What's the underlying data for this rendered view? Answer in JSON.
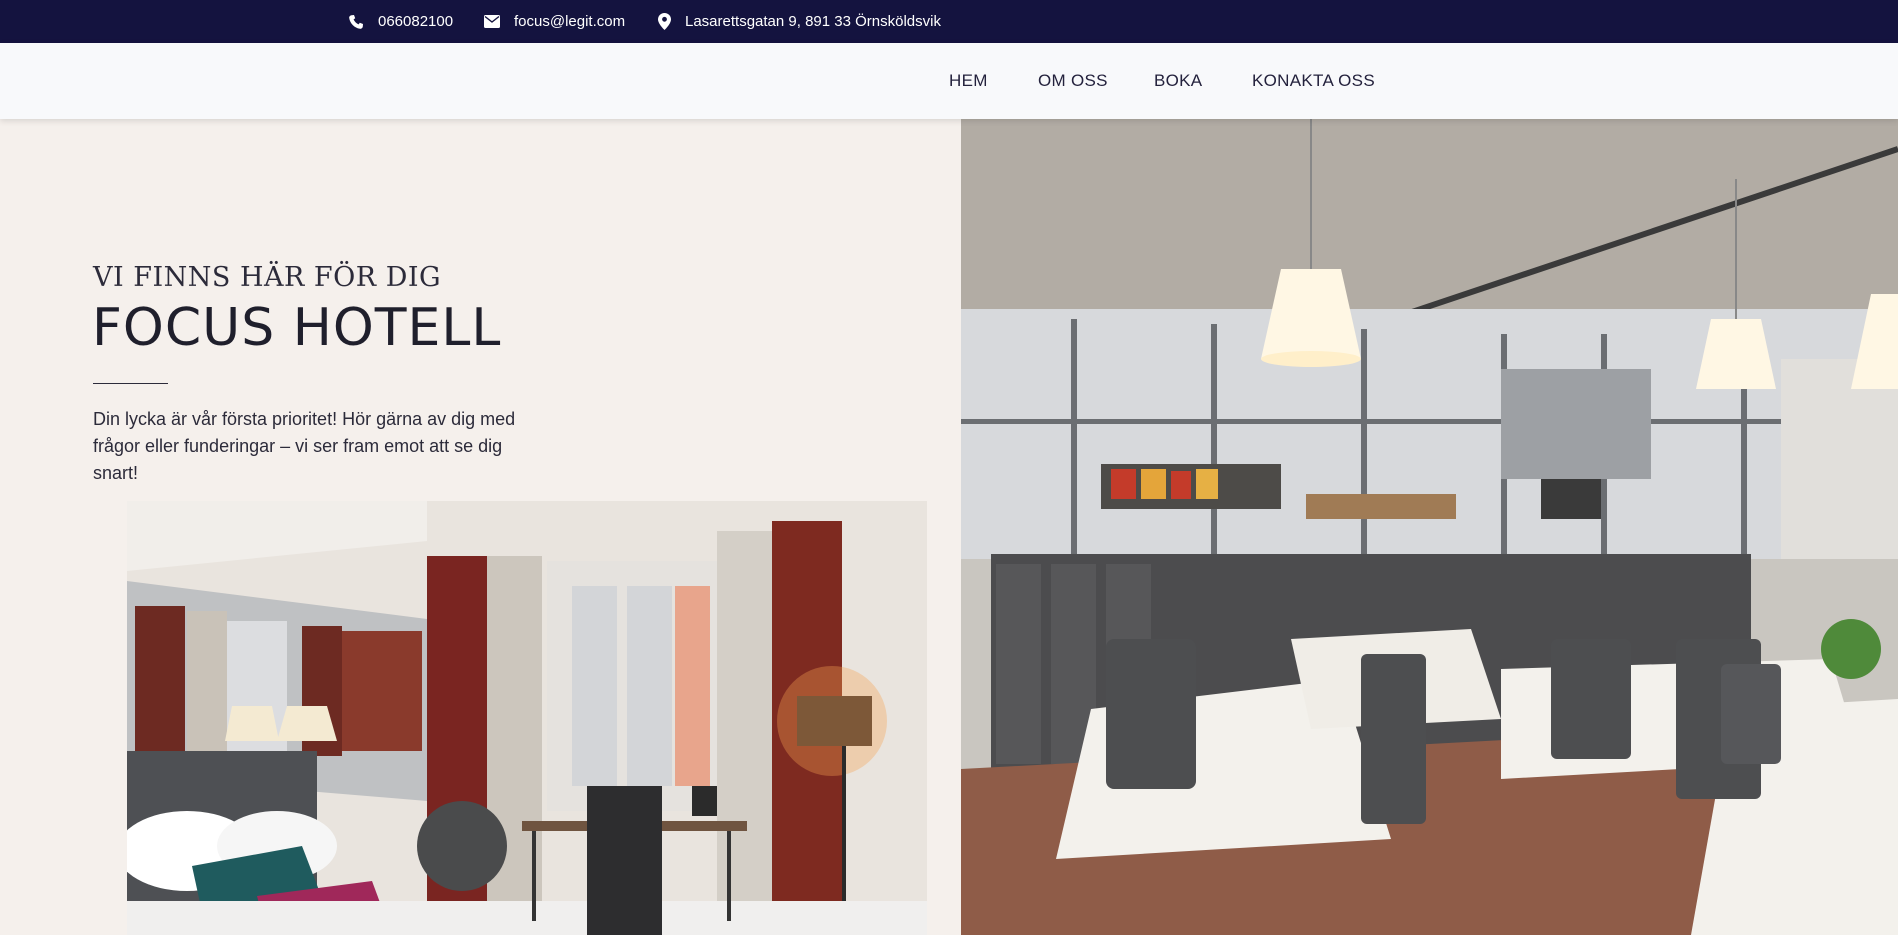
{
  "topbar": {
    "phone": "066082100",
    "email": "focus@legit.com",
    "address": "Lasarettsgatan 9, 891 33 Örnsköldsvik",
    "bg_color": "#14133f"
  },
  "nav": {
    "items": [
      {
        "label": "HEM"
      },
      {
        "label": "OM OSS"
      },
      {
        "label": "BOKA"
      },
      {
        "label": "KONAKTA OSS"
      }
    ]
  },
  "hero": {
    "subtitle": "VI FINNS HÄR FÖR DIG",
    "title": "FOCUS HOTELL",
    "text": "Din lycka är vår första prioritet! Hör gärna av dig med frågor eller funderingar – vi ser fram emot att se dig snart!"
  },
  "icons": {
    "phone": "phone-icon",
    "email": "envelope-icon",
    "address": "map-pin-icon"
  }
}
